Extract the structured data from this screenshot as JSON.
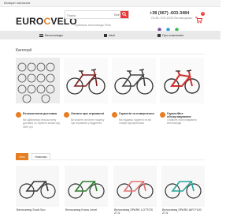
{
  "topbar": {
    "left_text": "Возврат магазина"
  },
  "logo": {
    "part1": "EURO",
    "part2": "C",
    "part3": "VELO"
  },
  "search": {
    "placeholder": "Поиск",
    "category": "Все",
    "subline": "Примеры: велосипеды Pride"
  },
  "contact": {
    "phone": "+38 (067) -603-3484",
    "hours": "Пн-Вс: 9:00-18:00 без выходных"
  },
  "cart": {
    "count": "0"
  },
  "nav": {
    "catalog": "Велосипеды",
    "item2": "Akal",
    "item3": "Про компанию"
  },
  "categories": {
    "title": "Категорії",
    "items": [
      {
        "label": ""
      },
      {
        "label": ""
      },
      {
        "label": ""
      },
      {
        "label": ""
      }
    ]
  },
  "features": [
    {
      "title": "Безкоштовна доставка",
      "text": "Ми здійснюємо безкоштовну доставку по Україні в межах від 3000 грн"
    },
    {
      "title": "Оплата при отриманні",
      "text": "Ви можете оплатити покупку при отриманні у відділенні"
    },
    {
      "title": "Гарантія та повернення",
      "text": "Ми надаємо гарантію на всі товари від виробника"
    },
    {
      "title": "Гарантійне обслуговування",
      "text": "Сервісне обслуговування велосипедів"
    }
  ],
  "products": {
    "tabs": [
      "Хіти",
      "Новинки"
    ],
    "items": [
      {
        "name": "Велосипед Scott Sco"
      },
      {
        "name": "Велосипед Kross Level"
      },
      {
        "name": "Велосипед SPARK LOTTOS 27.5"
      },
      {
        "name": "Велосипед SPARK AIR F100 27.5"
      }
    ]
  },
  "colors": {
    "accent": "#e67e22",
    "red": "#e33333"
  }
}
